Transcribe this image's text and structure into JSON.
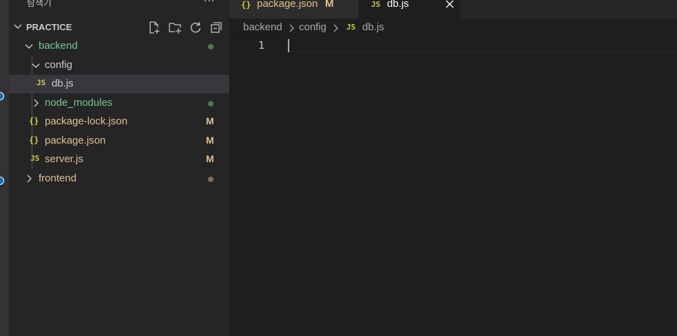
{
  "explorer": {
    "title": "탐색기",
    "more": "···",
    "project": "PRACTICE",
    "actions": [
      {
        "name": "new-file-icon"
      },
      {
        "name": "new-folder-icon"
      },
      {
        "name": "refresh-icon"
      },
      {
        "name": "collapse-all-icon"
      }
    ]
  },
  "tree": [
    {
      "label": "backend",
      "type": "folder",
      "expanded": true,
      "color": "#73c991",
      "status": "dot",
      "status_color": "#4b7a53"
    },
    {
      "label": "config",
      "type": "folder",
      "expanded": true,
      "color": "#cccccc"
    },
    {
      "label": "db.js",
      "type": "js",
      "icon": "JS",
      "color": "#cccccc",
      "selected": true
    },
    {
      "label": "node_modules",
      "type": "folder",
      "expanded": false,
      "color": "#73c991",
      "status": "dot",
      "status_color": "#4b7a53"
    },
    {
      "label": "package-lock.json",
      "type": "json",
      "icon": "{}",
      "color": "#e2c08d",
      "status": "M",
      "status_color": "#e2c08d"
    },
    {
      "label": "package.json",
      "type": "json",
      "icon": "{}",
      "color": "#e2c08d",
      "status": "M",
      "status_color": "#e2c08d"
    },
    {
      "label": "server.js",
      "type": "js",
      "icon": "JS",
      "color": "#e2c08d",
      "status": "M",
      "status_color": "#e2c08d"
    },
    {
      "label": "frontend",
      "type": "folder",
      "expanded": false,
      "color": "#e2c08d",
      "status": "dot",
      "status_color": "#7d6f55"
    }
  ],
  "tabs": [
    {
      "label": "package.json",
      "icon": "{}",
      "modified": "M",
      "color": "#e2c08d",
      "active": false
    },
    {
      "label": "db.js",
      "icon": "JS",
      "color": "#ffffff",
      "active": true,
      "close": "×"
    }
  ],
  "breadcrumb": {
    "segments": [
      "backend",
      "config"
    ],
    "file_icon": "JS",
    "file": "db.js"
  },
  "editor": {
    "line_numbers": [
      "1"
    ]
  },
  "colors": {
    "accent_badge": "#0e70c0",
    "js_icon": "#cbcb41",
    "modified": "#e2c08d",
    "untracked": "#73c991"
  }
}
